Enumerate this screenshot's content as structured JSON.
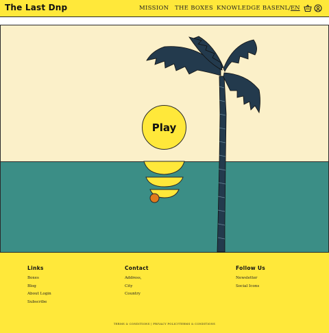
{
  "header": {
    "logo": "The Last Dnp",
    "nav": [
      "MISSION",
      "THE BOXES",
      "KNOWLEDGE BASE"
    ],
    "lang_nl": "NL",
    "lang_sep": "/",
    "lang_en": "EN",
    "icons": [
      "cart-icon",
      "user-icon"
    ]
  },
  "hero": {
    "play_label": "Play",
    "colors": {
      "sky": "#fbf0c9",
      "sea": "#3b8e86",
      "sun": "#ffe83a",
      "palm": "#233a4d",
      "ball": "#e07a1c"
    }
  },
  "footer": {
    "links": {
      "title": "Links",
      "items": [
        "Boxes",
        "Blog",
        "About Login",
        "Subscribe"
      ]
    },
    "contact": {
      "title": "Contact",
      "items": [
        "Address,",
        "City",
        "Country"
      ]
    },
    "follow": {
      "title": "Follow Us",
      "items": [
        "Newsletter",
        "Social Icons"
      ]
    },
    "legal": "TERMS & CONDITIONS | PRIVACY POLICYTERMS & CONDITIONS"
  }
}
